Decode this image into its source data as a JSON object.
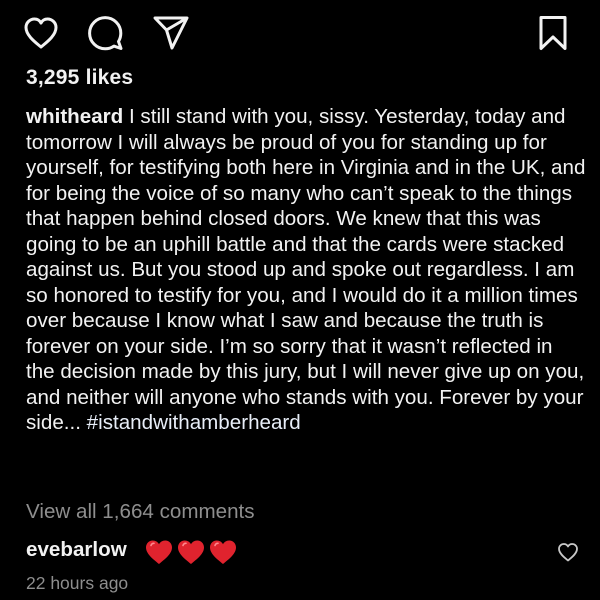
{
  "actions": {
    "like_icon": "heart-outline-icon",
    "comment_icon": "comment-bubble-icon",
    "share_icon": "paper-plane-icon",
    "save_icon": "bookmark-icon"
  },
  "likes_text": "3,295 likes",
  "caption": {
    "username": "whitheard",
    "text": " I still stand with you, sissy. Yesterday, today and tomorrow I will always be proud of you for standing up for yourself, for testifying both here in Virginia and in the UK, and for being the voice of so many who can’t speak to the things that happen behind closed doors. We knew that this was going to be an uphill battle and that the cards were stacked against us. But you stood up and spoke out regardless. I am so honored to testify for you, and I would do it a million times over because I know what I saw and because the truth is forever on your side. I’m so sorry that it wasn’t reflected in the decision made by this jury, but I will never give up on you, and neither will anyone who stands with you. Forever by your side...  ",
    "hashtag": "#istandwithamberheard"
  },
  "view_all_comments": "View all 1,664 comments",
  "top_comment": {
    "username": "evebarlow",
    "emoji_count": 3,
    "emoji_icon": "red-heart-emoji",
    "like_icon": "small-heart-outline-icon"
  },
  "timestamp": "22 hours ago",
  "colors": {
    "background": "#000000",
    "text_primary": "#f2f2f2",
    "text_secondary": "#8e8e8e",
    "heart_red": "#e0232e"
  }
}
